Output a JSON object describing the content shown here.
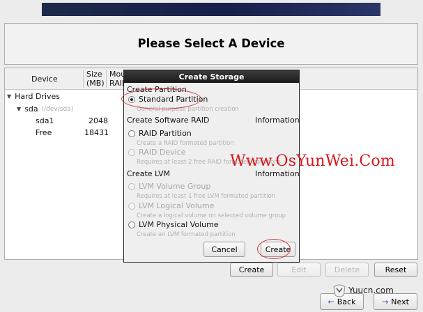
{
  "header": {
    "title": "Please Select A Device"
  },
  "device_list": {
    "columns": [
      {
        "key": "device",
        "label": "Device"
      },
      {
        "key": "size",
        "label": "Size\n(MB)"
      },
      {
        "key": "mount",
        "label": "Mou\nRAID"
      }
    ],
    "tree": {
      "group": "Hard Drives",
      "disk": {
        "name": "sda",
        "path": "(/dev/sda)"
      },
      "rows": [
        {
          "device": "sda1",
          "size": "2048"
        },
        {
          "device": "Free",
          "size": "18431"
        }
      ]
    }
  },
  "buttons": {
    "create": "Create",
    "edit": "Edit",
    "delete": "Delete",
    "reset": "Reset",
    "back": "Back",
    "next": "Next"
  },
  "dialog": {
    "title": "Create Storage",
    "create_partition": {
      "heading": "Create Partition",
      "standard_partition": {
        "label": "Standard Partition",
        "description": "General purpose partition creation",
        "selected": true
      }
    },
    "software_raid": {
      "heading": "Create Software RAID",
      "info": "Information",
      "raid_partition": {
        "label": "RAID Partition",
        "description": "Create a RAID formated partition"
      },
      "raid_device": {
        "label": "RAID Device",
        "description": "Requires at least 2 free RAID formated partitions"
      }
    },
    "lvm": {
      "heading": "Create LVM",
      "info": "Information",
      "volume_group": {
        "label": "LVM Volume Group",
        "description": "Requires at least 1 free LVM formated partition"
      },
      "logical_volume": {
        "label": "LVM Logical Volume",
        "description": "Create a logical volume on selected volume group"
      },
      "physical_volume": {
        "label": "LVM Physical Volume",
        "description": "Create an LVM formated partition"
      }
    },
    "cancel_label": "Cancel",
    "create_label": "Create"
  },
  "watermark": {
    "text": "Www.OsYunWei.Com",
    "site": "Yuucn.com"
  },
  "colors": {
    "annotation": "#d23a3a",
    "watermark": "#d8161a",
    "banner": "#1c2a4a"
  }
}
